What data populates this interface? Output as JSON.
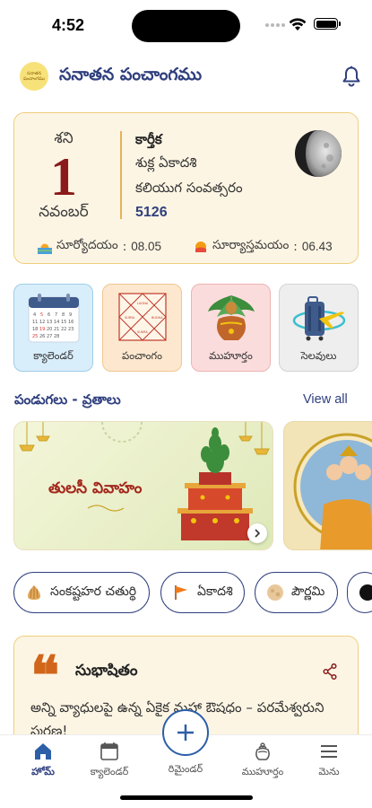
{
  "status_bar": {
    "time": "4:52"
  },
  "header": {
    "logo_text": "సనాతన పంచాంగము",
    "title": "సనాతన పంచాంగము"
  },
  "date_card": {
    "weekday": "శని",
    "day": "1",
    "month": "నవంబర్",
    "masa": "కార్తీక",
    "tithi": "శుక్ల ఏకాదశి",
    "samvatsaram": "కలియుగ సంవత్సరం",
    "year": "5126",
    "sunrise_label": "సూర్యోదయం",
    "sunrise_value": "08.05",
    "sunset_label": "సూర్యాస్తమయం",
    "sunset_value": "06.43",
    "moon_icon": "moon-phase-icon"
  },
  "tiles": [
    {
      "label": "క్యాలెండర్",
      "icon": "calendar-icon",
      "bg": "#d9eefb",
      "border": "#9fcde8"
    },
    {
      "label": "పంచాంగం",
      "icon": "panchangam-chart-icon",
      "bg": "#fde8cf",
      "border": "#f0c690"
    },
    {
      "label": "ముహూర్తం",
      "icon": "kalasam-icon",
      "bg": "#fbdcdc",
      "border": "#eeb3b3"
    },
    {
      "label": "సెలవులు",
      "icon": "suitcase-plane-icon",
      "bg": "#eeeeee",
      "border": "#d3d3d3"
    }
  ],
  "festivals": {
    "title": "పండుగలు - వ్రతాలు",
    "view_all": "View all",
    "banner_title": "తులసీ వివాహం"
  },
  "chips": [
    {
      "label": "సంకష్టహర చతుర్థి",
      "icon": "modak-icon"
    },
    {
      "label": "ఏకాదశి",
      "icon": "flag-icon"
    },
    {
      "label": "పౌర్ణమి",
      "icon": "full-moon-icon"
    },
    {
      "label": "",
      "icon": "new-moon-icon"
    }
  ],
  "quote": {
    "mark": "❝",
    "title": "సుభాషితం",
    "text": "అన్ని వ్యాధులపై ఉన్న ఏకైక మహా ఔషధం – పరమేశ్వరుని స్మరణ!"
  },
  "bottom_nav": {
    "home": "హోమ్",
    "calendar": "క్యాలెండర్",
    "reminder": "రిమైండర్",
    "muhurtam": "ముహూర్తం",
    "menu": "మెను"
  },
  "colors": {
    "primary": "#2f3f7e",
    "accent": "#8b1a1a",
    "card_bg": "#fdf5e4",
    "card_border": "#efcf7d"
  }
}
